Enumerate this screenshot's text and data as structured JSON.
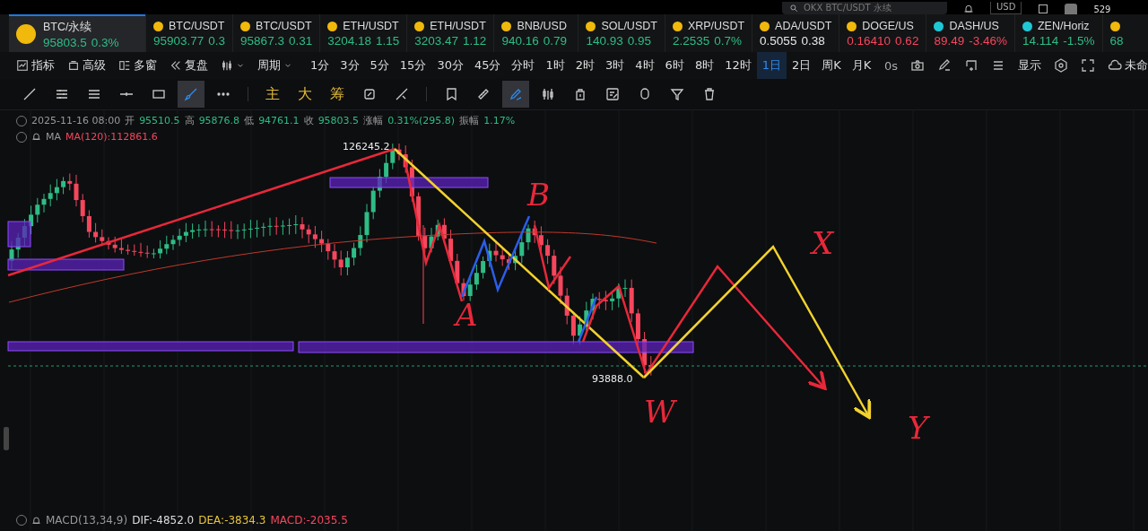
{
  "top_bar": {
    "search": {
      "placeholder": "OKX BTC/USDT 永续"
    },
    "currency": "USD",
    "account": "529"
  },
  "tickers": [
    {
      "pair": "BTC/永续",
      "coin": {
        "color": "#f0b90b"
      },
      "quote": {
        "price": "95803.5",
        "change": "0.3%",
        "color": "#2ebd85"
      },
      "selected": true
    },
    {
      "pair": "BTC/USDT",
      "coin": {
        "color": "#f0b90b"
      },
      "quote": {
        "price": "95903.77",
        "change": "0.3",
        "color": "#2ebd85"
      },
      "selected": false
    },
    {
      "pair": "BTC/USDT",
      "coin": {
        "color": "#f0b90b"
      },
      "quote": {
        "price": "95867.3",
        "change": "0.31",
        "color": "#2ebd85"
      },
      "selected": false
    },
    {
      "pair": "ETH/USDT",
      "coin": {
        "color": "#f0b90b"
      },
      "quote": {
        "price": "3204.18",
        "change": "1.15",
        "color": "#2ebd85"
      },
      "selected": false
    },
    {
      "pair": "ETH/USDT",
      "coin": {
        "color": "#f0b90b"
      },
      "quote": {
        "price": "3203.47",
        "change": "1.12",
        "color": "#2ebd85"
      },
      "selected": false
    },
    {
      "pair": "BNB/USD",
      "coin": {
        "color": "#f0b90b"
      },
      "quote": {
        "price": "940.16",
        "change": "0.79",
        "color": "#2ebd85"
      },
      "selected": false
    },
    {
      "pair": "SOL/USDT",
      "coin": {
        "color": "#f0b90b"
      },
      "quote": {
        "price": "140.93",
        "change": "0.95",
        "color": "#2ebd85"
      },
      "selected": false
    },
    {
      "pair": "XRP/USDT",
      "coin": {
        "color": "#f0b90b"
      },
      "quote": {
        "price": "2.2535",
        "change": "0.7%",
        "color": "#2ebd85"
      },
      "selected": false
    },
    {
      "pair": "ADA/USDT",
      "coin": {
        "color": "#f0b90b"
      },
      "quote": {
        "price": "0.5055",
        "change": "0.38",
        "color": "#e8e8e8"
      },
      "selected": false
    },
    {
      "pair": "DOGE/US",
      "coin": {
        "color": "#f0b90b"
      },
      "quote": {
        "price": "0.16410",
        "change": "0.62",
        "color": "#f6465d"
      },
      "selected": false
    },
    {
      "pair": "DASH/US",
      "coin": {
        "color": "#1fc7d4"
      },
      "quote": {
        "price": "89.49",
        "change": "-3.46%",
        "color": "#f6465d"
      },
      "selected": false
    },
    {
      "pair": "ZEN/Horiz",
      "coin": {
        "color": "#1fc7d4"
      },
      "quote": {
        "price": "14.114",
        "change": "-1.5%",
        "color": "#2ebd85"
      },
      "selected": false
    },
    {
      "coin": {
        "color": "#f0b90b"
      },
      "quote": {
        "price": "68",
        "color": "#2ebd85"
      },
      "selected": false
    }
  ],
  "toolbar": {
    "menus": [
      "指标",
      "高级",
      "多窗",
      "复盘"
    ],
    "period": "周期",
    "intervals": [
      {
        "label": "1分",
        "selected": false
      },
      {
        "label": "3分",
        "selected": false
      },
      {
        "label": "5分",
        "selected": false
      },
      {
        "label": "15分",
        "selected": false
      },
      {
        "label": "30分",
        "selected": false
      },
      {
        "label": "45分",
        "selected": false
      },
      {
        "label": "分时",
        "selected": false
      },
      {
        "label": "1时",
        "selected": false
      },
      {
        "label": "2时",
        "selected": false
      },
      {
        "label": "3时",
        "selected": false
      },
      {
        "label": "4时",
        "selected": false
      },
      {
        "label": "6时",
        "selected": false
      },
      {
        "label": "8时",
        "selected": false
      },
      {
        "label": "12时",
        "selected": false
      },
      {
        "label": "1日",
        "selected": true
      },
      {
        "label": "2日",
        "selected": false
      },
      {
        "label": "周K",
        "selected": false
      },
      {
        "label": "月K",
        "selected": false
      }
    ],
    "countdown": "0s",
    "display": "显示",
    "layout_name": "未命"
  },
  "drawing_tools": [
    {
      "kind": "icon",
      "selected": false
    },
    {
      "kind": "icon",
      "selected": false
    },
    {
      "kind": "icon",
      "selected": false
    },
    {
      "kind": "icon",
      "selected": false
    },
    {
      "kind": "icon",
      "selected": false
    },
    {
      "kind": "icon",
      "selected": true
    },
    {
      "kind": "icon",
      "selected": false
    },
    {
      "kind": "separator"
    },
    {
      "kind": "text",
      "label": "主"
    },
    {
      "kind": "text",
      "label": "大"
    },
    {
      "kind": "text",
      "label": "筹"
    },
    {
      "kind": "icon",
      "selected": false
    },
    {
      "kind": "icon",
      "selected": false
    },
    {
      "kind": "separator"
    },
    {
      "kind": "icon",
      "selected": false
    },
    {
      "kind": "icon",
      "selected": false
    },
    {
      "kind": "icon",
      "selected": true
    },
    {
      "kind": "icon",
      "selected": false
    },
    {
      "kind": "icon",
      "selected": false
    },
    {
      "kind": "icon",
      "selected": false
    },
    {
      "kind": "icon",
      "selected": false
    },
    {
      "kind": "icon",
      "selected": false
    },
    {
      "kind": "icon",
      "selected": false
    }
  ],
  "info": {
    "date": "2025-11-16 08:00",
    "fields": [
      {
        "label": "开",
        "value": "95510.5"
      },
      {
        "label": "高",
        "value": "95876.8"
      },
      {
        "label": "低",
        "value": "94761.1"
      },
      {
        "label": "收",
        "value": "95803.5"
      },
      {
        "label": "涨幅",
        "value": "0.31%(295.8)"
      },
      {
        "label": "振幅",
        "value": "1.17%"
      }
    ]
  },
  "ma": {
    "name": "MA",
    "value": "MA(120):112861.6"
  },
  "chart": {
    "high_label": "126245.2",
    "low_label": "93888.0",
    "handwriting": [
      "B",
      "A",
      "W",
      "X",
      "Y"
    ]
  },
  "macd": {
    "name": "MACD(13,34,9)",
    "dif": "DIF:-4852.0",
    "dea": "DEA:-3834.3",
    "macd": "MACD:-2035.5"
  }
}
